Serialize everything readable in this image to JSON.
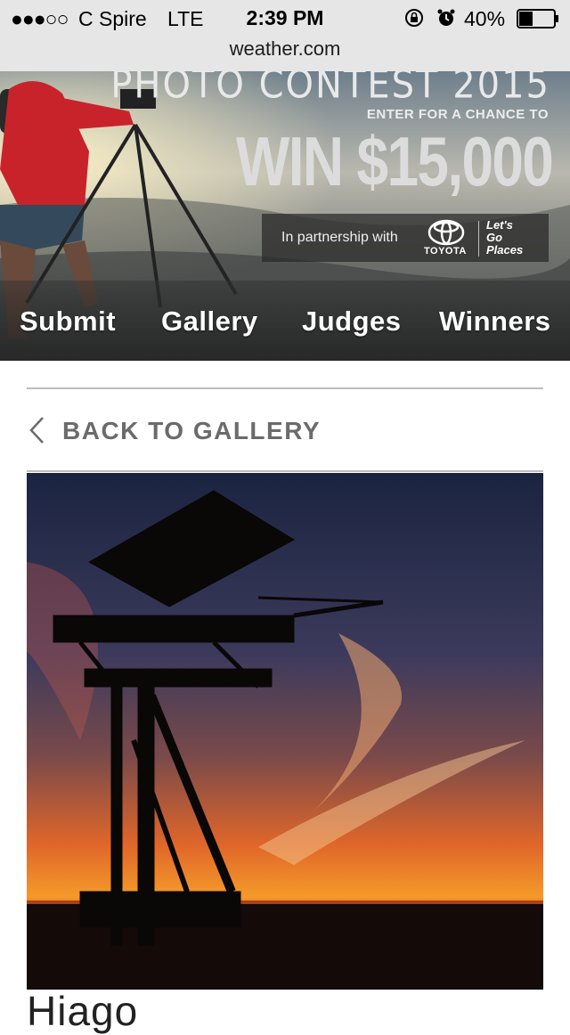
{
  "status_bar": {
    "signal": "●●●○○",
    "carrier": "C Spire",
    "network": "LTE",
    "time": "2:39 PM",
    "battery_percent": "40%",
    "battery_level": 0.4,
    "icons": [
      "rotation-lock-icon",
      "alarm-icon",
      "battery-icon"
    ]
  },
  "address_bar": {
    "url": "weather.com"
  },
  "banner": {
    "contest_title": "PHOTO CONTEST 2015",
    "enter_text": "ENTER FOR A CHANCE TO",
    "prize_text": "WIN $15,000",
    "partnership_text": "In partnership with",
    "sponsor": "TOYOTA",
    "slogan_lines": [
      "Let's",
      "Go",
      "Places"
    ]
  },
  "nav": {
    "items": [
      {
        "label": "Submit"
      },
      {
        "label": "Gallery"
      },
      {
        "label": "Judges"
      },
      {
        "label": "Winners"
      }
    ]
  },
  "back": {
    "label": "BACK TO GALLERY"
  },
  "photo": {
    "title": "Hiago"
  },
  "colors": {
    "nav_text": "#ffffff",
    "back_text": "#6b6b6b",
    "rule": "#bdbdbd",
    "sunset_orange": "#f06a1a"
  }
}
